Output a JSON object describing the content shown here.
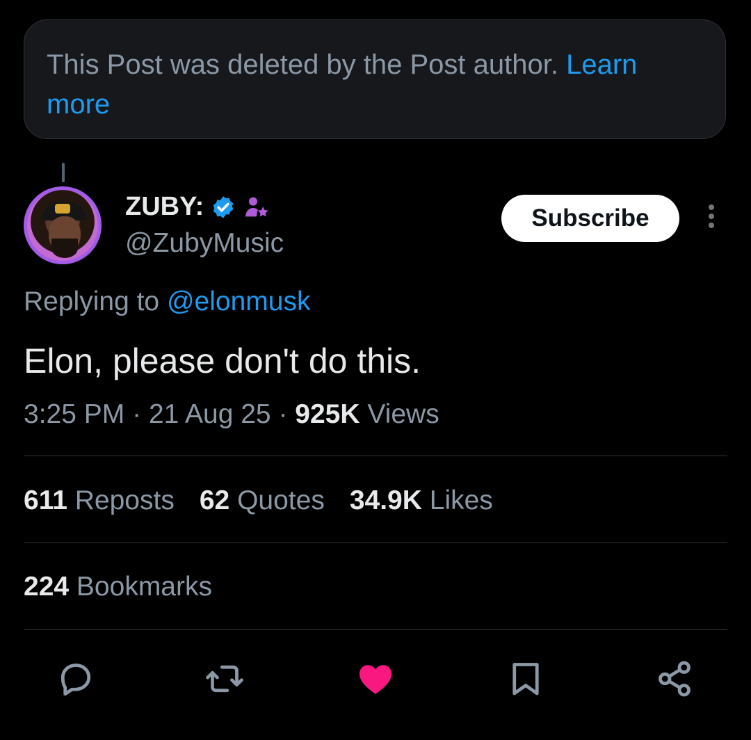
{
  "deleted_notice": {
    "text": "This Post was deleted by the Post author.",
    "link": "Learn more"
  },
  "author": {
    "display_name": "ZUBY:",
    "handle": "@ZubyMusic",
    "verified": true
  },
  "subscribe_label": "Subscribe",
  "reply_to": {
    "prefix": "Replying to",
    "mention": "@elonmusk"
  },
  "post": {
    "text": "Elon, please don't do this.",
    "time": "3:25 PM",
    "date": "21 Aug 25",
    "views_count": "925K",
    "views_label": "Views",
    "separator": "·"
  },
  "stats": {
    "reposts_count": "611",
    "reposts_label": "Reposts",
    "quotes_count": "62",
    "quotes_label": "Quotes",
    "likes_count": "34.9K",
    "likes_label": "Likes",
    "bookmarks_count": "224",
    "bookmarks_label": "Bookmarks"
  },
  "actions": [
    "reply-icon",
    "repost-icon",
    "like-icon",
    "bookmark-icon",
    "share-icon"
  ],
  "colors": {
    "background": "#000000",
    "accent": "#1d9bf0",
    "secondary_text": "#8b98a5",
    "like_active": "#f91880",
    "avatar_ring": "#a35be8",
    "verified_badge": "#1d9bf0",
    "affiliate_icon": "#b05bd9"
  }
}
